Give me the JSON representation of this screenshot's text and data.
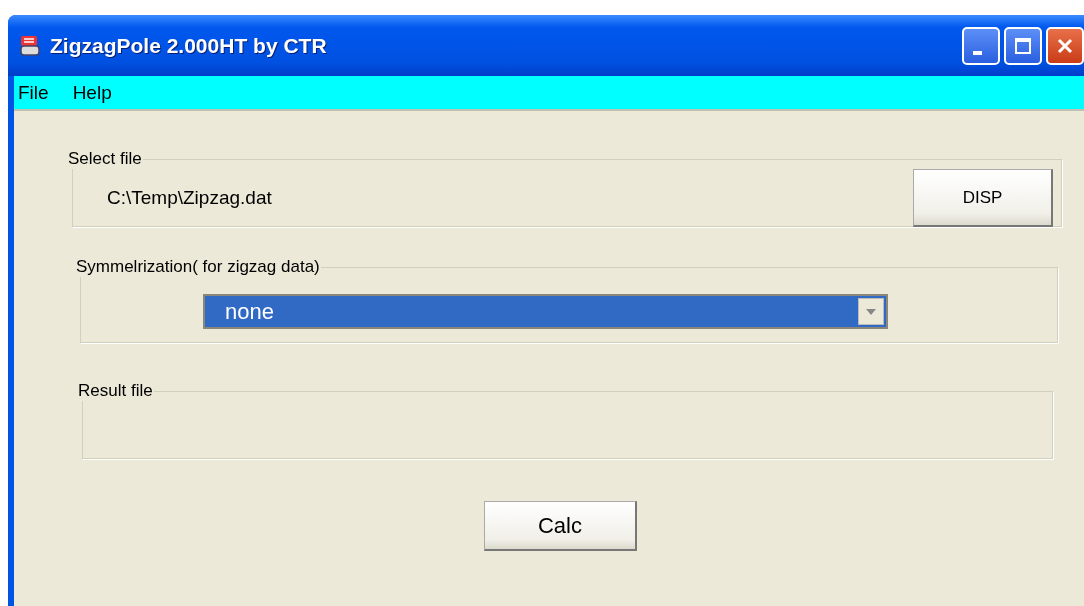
{
  "window": {
    "title": "ZigzagPole 2.000HT by CTR"
  },
  "menu": [
    {
      "label": "File"
    },
    {
      "label": "Help"
    }
  ],
  "select_file": {
    "label": "Select file",
    "path": "C:\\Temp\\Zipzag.dat",
    "button": "DISP"
  },
  "symmetrization": {
    "label": "Symmelrization( for zigzag data)",
    "value": "none",
    "focused": true
  },
  "result_file": {
    "label": "Result file"
  },
  "buttons": [
    "Calc"
  ]
}
